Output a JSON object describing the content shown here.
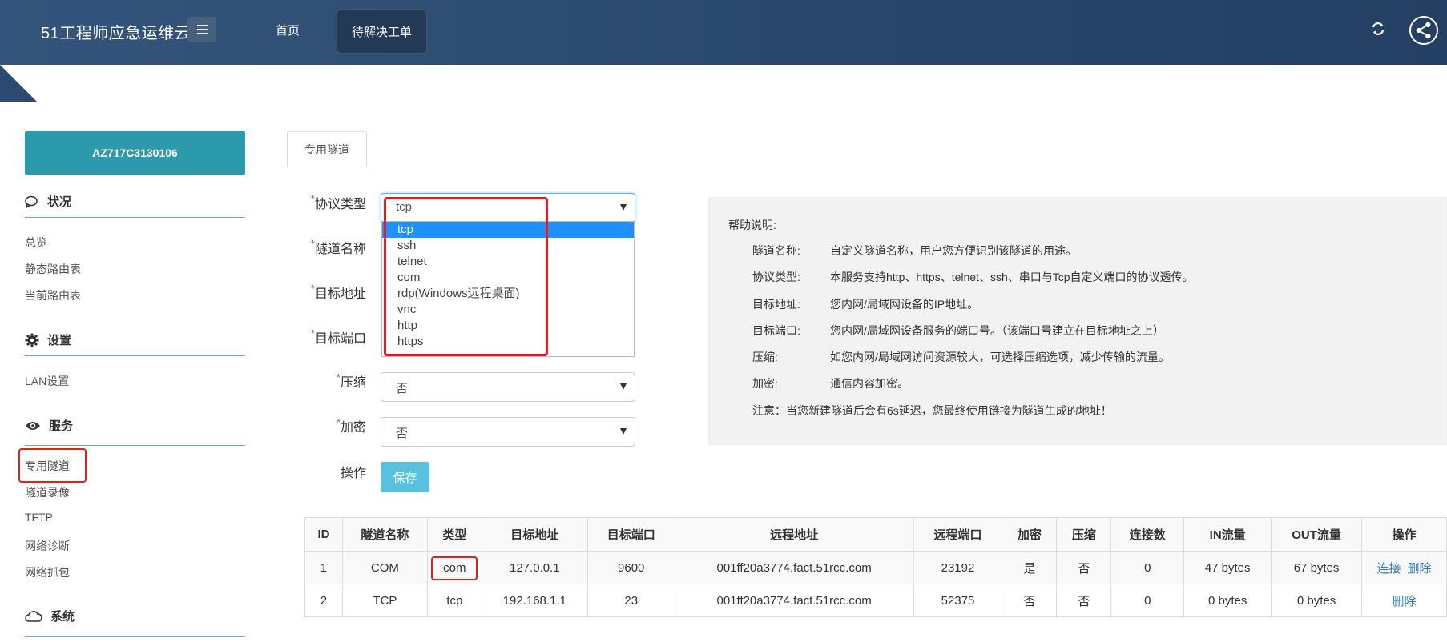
{
  "header": {
    "brand": "51工程师应急运维云",
    "nav_home": "首页",
    "nav_active": "待解决工单",
    "icons": [
      "menu-icon",
      "refresh-icon",
      "share-icon"
    ]
  },
  "sidebar": {
    "device_id": "AZ717C3130106",
    "sections": [
      {
        "title": "状况",
        "icon": "chat-icon",
        "items": [
          "总览",
          "静态路由表",
          "当前路由表"
        ]
      },
      {
        "title": "设置",
        "icon": "gear-icon",
        "items": [
          "LAN设置"
        ]
      },
      {
        "title": "服务",
        "icon": "eye-icon",
        "items": [
          "专用隧道",
          "隧道录像",
          "TFTP",
          "网络诊断",
          "网络抓包"
        ]
      },
      {
        "title": "系统",
        "icon": "cloud-icon",
        "items": []
      }
    ]
  },
  "tab": {
    "label": "专用隧道"
  },
  "form": {
    "required_mark": "*",
    "protocol_label": "协议类型",
    "protocol_value": "tcp",
    "protocol_options": [
      "tcp",
      "ssh",
      "telnet",
      "com",
      "rdp(Windows远程桌面)",
      "vnc",
      "http",
      "https"
    ],
    "name_label": "隧道名称",
    "addr_label": "目标地址",
    "port_label": "目标端口",
    "compress_label": "压缩",
    "compress_value": "否",
    "encrypt_label": "加密",
    "encrypt_value": "否",
    "action_label": "操作",
    "save_label": "保存"
  },
  "help": {
    "title": "帮助说明:",
    "rows": [
      {
        "k": "隧道名称:",
        "v": "自定义隧道名称，用户您方便识别该隧道的用途。"
      },
      {
        "k": "协议类型:",
        "v": "本服务支持http、https、telnet、ssh、串口与Tcp自定义端口的协议透传。"
      },
      {
        "k": "目标地址:",
        "v": "您内网/局域网设备的IP地址。"
      },
      {
        "k": "目标端口:",
        "v": "您内网/局域网设备服务的端口号。（该端口号建立在目标地址之上）"
      },
      {
        "k": "压缩:",
        "v": "如您内网/局域网访问资源较大，可选择压缩选项，减少传输的流量。"
      },
      {
        "k": "加密:",
        "v": "通信内容加密。"
      }
    ],
    "note": "注意：当您新建隧道后会有6s延迟，您最终使用链接为隧道生成的地址！"
  },
  "table": {
    "headers": [
      "ID",
      "隧道名称",
      "类型",
      "目标地址",
      "目标端口",
      "远程地址",
      "远程端口",
      "加密",
      "压缩",
      "连接数",
      "IN流量",
      "OUT流量",
      "操作"
    ],
    "rows": [
      {
        "id": "1",
        "name": "COM",
        "type": "com",
        "addr": "127.0.0.1",
        "port": "9600",
        "remote": "001ff20a3774.fact.51rcc.com",
        "rport": "23192",
        "enc": "是",
        "comp": "否",
        "conn": "0",
        "in": "47 bytes",
        "out": "67 bytes",
        "act1": "连接",
        "act2": "删除"
      },
      {
        "id": "2",
        "name": "TCP",
        "type": "tcp",
        "addr": "192.168.1.1",
        "port": "23",
        "remote": "001ff20a3774.fact.51rcc.com",
        "rport": "52375",
        "enc": "否",
        "comp": "否",
        "conn": "0",
        "in": "0 bytes",
        "out": "0 bytes",
        "act1": "",
        "act2": "删除"
      }
    ]
  },
  "colors": {
    "header_bg": "#2b4a6f",
    "accent": "#2b9aad",
    "save_btn": "#5bc0de",
    "highlight": "#e02020",
    "dropdown_selected": "#1e90ff"
  }
}
